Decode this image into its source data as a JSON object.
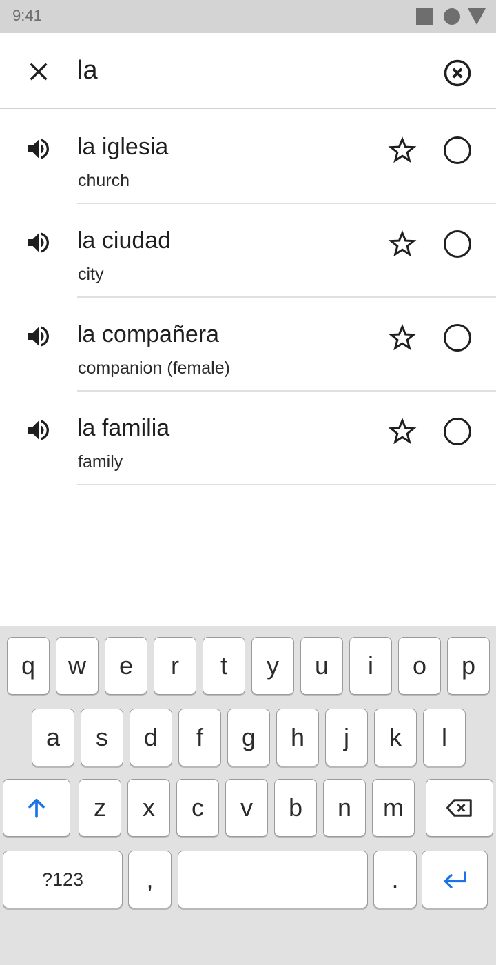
{
  "status_bar": {
    "time": "9:41",
    "icons": [
      "square-icon",
      "circle-icon",
      "triangle-icon"
    ]
  },
  "search": {
    "value": "la",
    "close_icon": "close-icon",
    "clear_icon": "clear-circle-icon"
  },
  "results": [
    {
      "term": "la iglesia",
      "translation": "church"
    },
    {
      "term": "la ciudad",
      "translation": "city"
    },
    {
      "term": "la compañera",
      "translation": "companion (female)"
    },
    {
      "term": "la familia",
      "translation": "family"
    }
  ],
  "row_icons": {
    "speaker": "speaker-icon",
    "star": "star-outline-icon",
    "select": "radio-circle-icon"
  },
  "keyboard": {
    "row1": [
      "q",
      "w",
      "e",
      "r",
      "t",
      "y",
      "u",
      "i",
      "o",
      "p"
    ],
    "row2": [
      "a",
      "s",
      "d",
      "f",
      "g",
      "h",
      "j",
      "k",
      "l"
    ],
    "row3": [
      "z",
      "x",
      "c",
      "v",
      "b",
      "n",
      "m"
    ],
    "shift_icon": "shift-arrow-icon",
    "backspace_icon": "backspace-icon",
    "symbols_label": "?123",
    "comma_label": ",",
    "period_label": ".",
    "enter_icon": "enter-icon"
  },
  "colors": {
    "accent": "#1a73e8",
    "status_bar_bg": "#d4d4d4",
    "keyboard_bg": "#e1e1e1",
    "text": "#1f1f1f"
  }
}
